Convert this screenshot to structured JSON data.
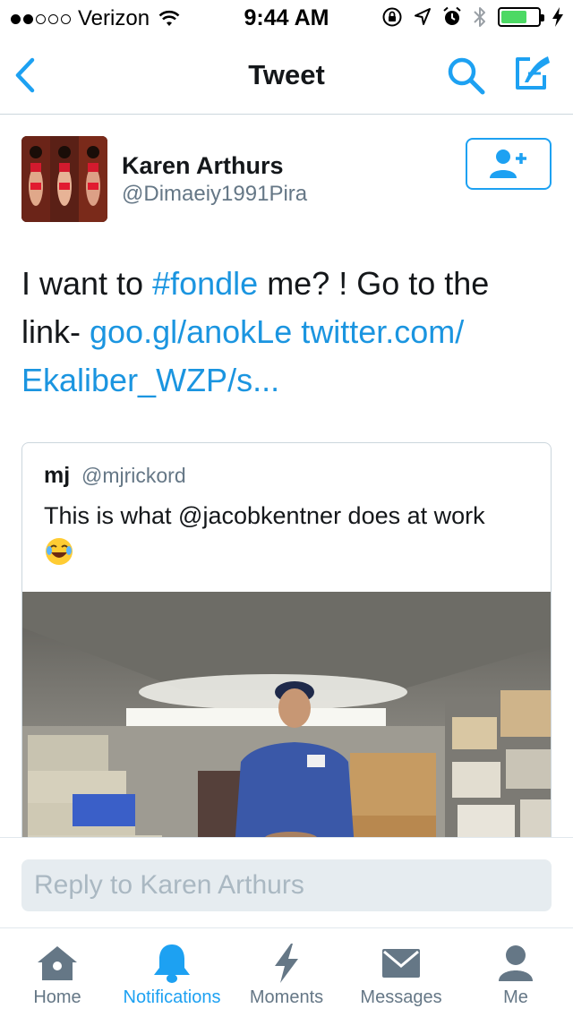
{
  "status_bar": {
    "carrier": "Verizon",
    "time": "9:44 AM",
    "signal_dots_filled": 2,
    "signal_dots_total": 5,
    "battery_fraction": 0.7,
    "battery_color": "#4cd964"
  },
  "nav": {
    "title": "Tweet",
    "back_icon": "chevron-left-icon",
    "search_icon": "search-icon",
    "compose_icon": "compose-icon"
  },
  "tweet": {
    "author_name": "Karen Arthurs",
    "author_handle": "@Dimaeiy1991Pira",
    "text_prefix": "I want to ",
    "hashtag": "#fondle",
    "text_middle": " me? !  Go to the link-    ",
    "link1": "goo.gl/anokLe",
    "link2": " twitter.com/ Ekaliber_WZP/s...",
    "follow_icon": "add-user-icon"
  },
  "quote": {
    "name": "mj",
    "handle": "@mjrickord",
    "text": "This is what @jacobkentner does at work",
    "emoji": "😂"
  },
  "reply": {
    "placeholder": "Reply to Karen Arthurs"
  },
  "tabs": [
    {
      "label": "Home",
      "icon": "home-icon",
      "active": false
    },
    {
      "label": "Notifications",
      "icon": "bell-icon",
      "active": true
    },
    {
      "label": "Moments",
      "icon": "lightning-icon",
      "active": false
    },
    {
      "label": "Messages",
      "icon": "envelope-icon",
      "active": false
    },
    {
      "label": "Me",
      "icon": "person-icon",
      "active": false
    }
  ],
  "colors": {
    "accent": "#1da1f2",
    "link": "#1b95e0",
    "secondary_text": "#657786",
    "inactive_icon": "#657786"
  }
}
